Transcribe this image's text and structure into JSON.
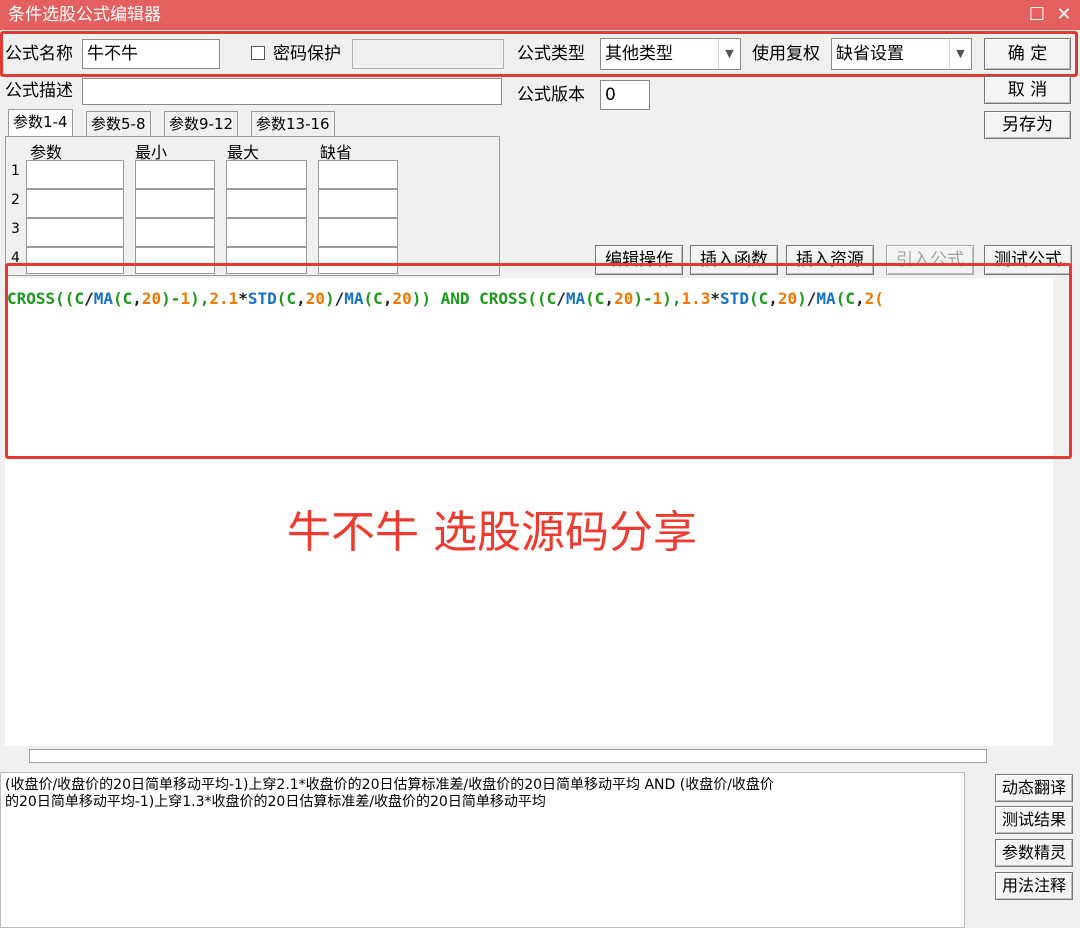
{
  "window": {
    "title": "条件选股公式编辑器",
    "maximize_glyph": "☐",
    "close_glyph": "✕"
  },
  "form": {
    "name_label": "公式名称",
    "name_value": "牛不牛",
    "password_label": "密码保护",
    "password_checked": false,
    "password_value": "",
    "type_label": "公式类型",
    "type_value": "其他类型",
    "fuquan_label": "使用复权",
    "fuquan_value": "缺省设置",
    "desc_label": "公式描述",
    "desc_value": "",
    "version_label": "公式版本",
    "version_value": "0"
  },
  "buttons": {
    "ok": "确 定",
    "cancel": "取 消",
    "save_as": "另存为",
    "edit_ops": "编辑操作",
    "insert_func": "插入函数",
    "insert_res": "插入资源",
    "import_formula": "引入公式",
    "test_formula": "测试公式"
  },
  "tabs": [
    "参数1-4",
    "参数5-8",
    "参数9-12",
    "参数13-16"
  ],
  "params": {
    "headers": [
      "参数",
      "最小",
      "最大",
      "缺省"
    ],
    "rows": [
      "1",
      "2",
      "3",
      "4"
    ]
  },
  "code": {
    "tokens": [
      {
        "t": "CROSS((",
        "c": "green"
      },
      {
        "t": "C",
        "c": "green"
      },
      {
        "t": "/",
        "c": "black"
      },
      {
        "t": "MA",
        "c": "blue"
      },
      {
        "t": "(",
        "c": "green"
      },
      {
        "t": "C",
        "c": "green"
      },
      {
        "t": ",",
        "c": "black"
      },
      {
        "t": "20",
        "c": "orange"
      },
      {
        "t": ")-",
        "c": "green"
      },
      {
        "t": "1",
        "c": "orange"
      },
      {
        "t": "),",
        "c": "green"
      },
      {
        "t": "2.1",
        "c": "orange"
      },
      {
        "t": "*",
        "c": "black"
      },
      {
        "t": "STD",
        "c": "blue"
      },
      {
        "t": "(",
        "c": "green"
      },
      {
        "t": "C",
        "c": "green"
      },
      {
        "t": ",",
        "c": "black"
      },
      {
        "t": "20",
        "c": "orange"
      },
      {
        "t": ")",
        "c": "green"
      },
      {
        "t": "/",
        "c": "black"
      },
      {
        "t": "MA",
        "c": "blue"
      },
      {
        "t": "(",
        "c": "green"
      },
      {
        "t": "C",
        "c": "green"
      },
      {
        "t": ",",
        "c": "black"
      },
      {
        "t": "20",
        "c": "orange"
      },
      {
        "t": ")) ",
        "c": "green"
      },
      {
        "t": "AND ",
        "c": "green"
      },
      {
        "t": "CROSS((",
        "c": "green"
      },
      {
        "t": "C",
        "c": "green"
      },
      {
        "t": "/",
        "c": "black"
      },
      {
        "t": "MA",
        "c": "blue"
      },
      {
        "t": "(",
        "c": "green"
      },
      {
        "t": "C",
        "c": "green"
      },
      {
        "t": ",",
        "c": "black"
      },
      {
        "t": "20",
        "c": "orange"
      },
      {
        "t": ")-",
        "c": "green"
      },
      {
        "t": "1",
        "c": "orange"
      },
      {
        "t": "),",
        "c": "green"
      },
      {
        "t": "1.3",
        "c": "orange"
      },
      {
        "t": "*",
        "c": "black"
      },
      {
        "t": "STD",
        "c": "blue"
      },
      {
        "t": "(",
        "c": "green"
      },
      {
        "t": "C",
        "c": "green"
      },
      {
        "t": ",",
        "c": "black"
      },
      {
        "t": "20",
        "c": "orange"
      },
      {
        "t": ")",
        "c": "green"
      },
      {
        "t": "/",
        "c": "black"
      },
      {
        "t": "MA",
        "c": "blue"
      },
      {
        "t": "(",
        "c": "green"
      },
      {
        "t": "C",
        "c": "green"
      },
      {
        "t": ",",
        "c": "black"
      },
      {
        "t": "2(",
        "c": "orange"
      }
    ]
  },
  "overlay_text": "牛不牛 选股源码分享",
  "translation": {
    "line1": "(收盘价/收盘价的20日简单移动平均-1)上穿2.1*收盘价的20日估算标准差/收盘价的20日简单移动平均 AND (收盘价/收盘价",
    "line2": "的20日简单移动平均-1)上穿1.3*收盘价的20日估算标准差/收盘价的20日简单移动平均"
  },
  "side_buttons": [
    "动态翻译",
    "测试结果",
    "参数精灵",
    "用法注释"
  ],
  "colors": {
    "titlebar": "#e3605f",
    "highlight": "#e23a32",
    "code_green": "#1a9a1a",
    "code_blue": "#1470c8",
    "code_orange": "#f07800"
  }
}
